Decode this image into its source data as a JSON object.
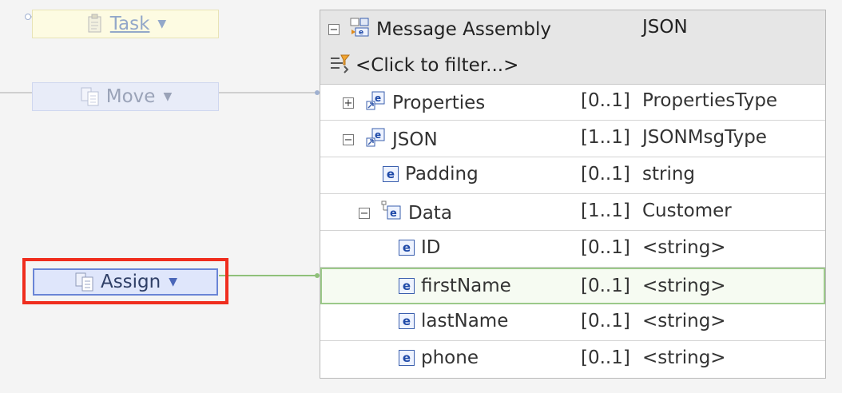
{
  "nodes": {
    "task": {
      "label": "Task"
    },
    "move": {
      "label": "Move"
    },
    "assign": {
      "label": "Assign"
    }
  },
  "message_tree": {
    "header": {
      "title": "Message Assembly",
      "type": "JSON",
      "filter": "<Click to filter...>"
    },
    "rows": [
      {
        "name": "Properties",
        "cardinality": "[0..1]",
        "type": "PropertiesType"
      },
      {
        "name": "JSON",
        "cardinality": "[1..1]",
        "type": "JSONMsgType"
      },
      {
        "name": "Padding",
        "cardinality": "[0..1]",
        "type": "string"
      },
      {
        "name": "Data",
        "cardinality": "[1..1]",
        "type": "Customer"
      },
      {
        "name": "ID",
        "cardinality": "[0..1]",
        "type": "<string>"
      },
      {
        "name": "firstName",
        "cardinality": "[0..1]",
        "type": "<string>"
      },
      {
        "name": "lastName",
        "cardinality": "[0..1]",
        "type": "<string>"
      },
      {
        "name": "phone",
        "cardinality": "[0..1]",
        "type": "<string>"
      }
    ]
  },
  "colors": {
    "highlight": "#ef2d1e",
    "connection_active": "#8fc07a",
    "connection_inactive": "#cfcfcf"
  },
  "icons": [
    "collapse-icon",
    "expand-icon",
    "message-assembly-icon",
    "filter-icon",
    "complex-element-icon",
    "element-icon",
    "transform-icon",
    "dropdown-icon"
  ]
}
